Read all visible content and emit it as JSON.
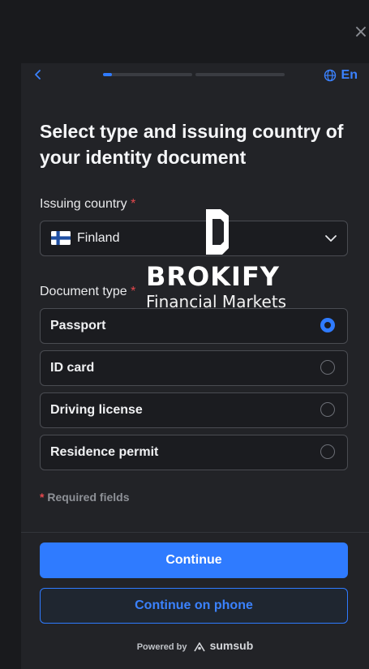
{
  "colors": {
    "accent": "#2f7bff",
    "required": "#e5484d",
    "panel": "#222327",
    "backdrop": "#191a1d"
  },
  "close_icon": "close-icon",
  "header": {
    "language": "En",
    "progress": {
      "steps": 2,
      "current": 1,
      "current_fraction": 0.1
    }
  },
  "page": {
    "title": "Select type and issuing country of your identity document"
  },
  "country": {
    "label": "Issuing country",
    "required_mark": "*",
    "value": "Finland",
    "flag_icon": "finland-flag-icon"
  },
  "document": {
    "label": "Document type",
    "required_mark": "*",
    "options": [
      {
        "label": "Passport",
        "selected": true
      },
      {
        "label": "ID card",
        "selected": false
      },
      {
        "label": "Driving license",
        "selected": false
      },
      {
        "label": "Residence permit",
        "selected": false
      }
    ]
  },
  "required_note": {
    "mark": "*",
    "text": "Required fields"
  },
  "actions": {
    "continue": "Continue",
    "continue_phone": "Continue on phone"
  },
  "footer": {
    "powered_by": "Powered by",
    "brand": "sumsub"
  },
  "watermark": {
    "title": "BROKIFY",
    "subtitle": "Financial Markets"
  }
}
